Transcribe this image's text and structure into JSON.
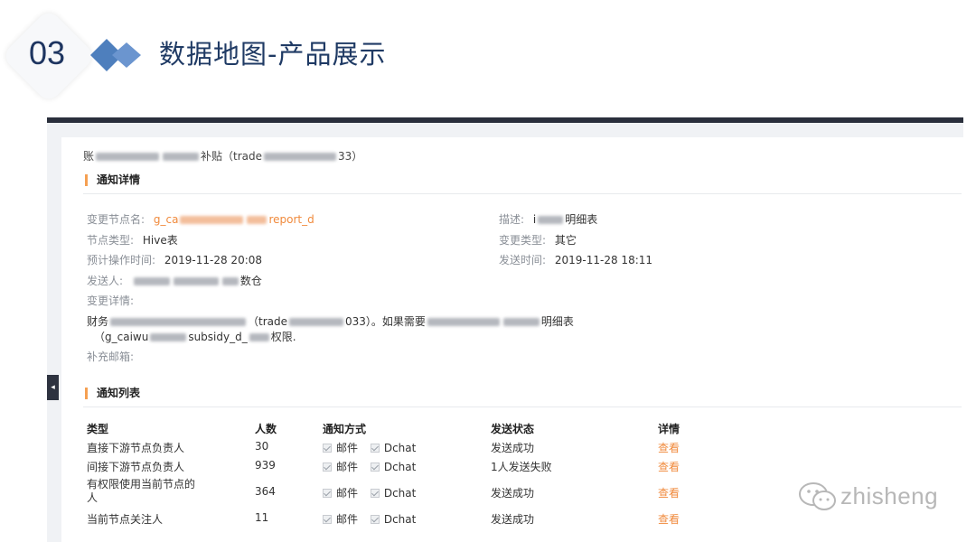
{
  "slide": {
    "number": "03",
    "title": "数据地图-产品展示"
  },
  "breadcrumb": {
    "prefix": "账",
    "middle": "补贴（trade",
    "suffix": "33）"
  },
  "detail_section": {
    "title": "通知详情",
    "fields": {
      "node_name_label": "变更节点名:",
      "node_name_prefix": "g_ca",
      "node_name_suffix": "report_d",
      "desc_label": "描述:",
      "desc_prefix": "i",
      "desc_suffix": "明细表",
      "node_type_label": "节点类型:",
      "node_type_value": "Hive表",
      "change_type_label": "变更类型:",
      "change_type_value": "其它",
      "planned_time_label": "预计操作时间:",
      "planned_time_value": "2019-11-28 20:08",
      "send_time_label": "发送时间:",
      "send_time_value": "2019-11-28 18:11",
      "sender_label": "发送人:",
      "sender_suffix": "数仓",
      "change_detail_label": "变更详情:",
      "change_detail_line1_a": "财务",
      "change_detail_line1_b": "（trade",
      "change_detail_line1_c": "033）。如果需要",
      "change_detail_line1_d": "明细表",
      "change_detail_line2_a": "（g_caiwu",
      "change_detail_line2_b": "subsidy_d_",
      "change_detail_line2_c": "权限.",
      "extra_email_label": "补充邮箱:"
    }
  },
  "list_section": {
    "title": "通知列表",
    "headers": [
      "类型",
      "人数",
      "通知方式",
      "发送状态",
      "详情"
    ],
    "method_labels": [
      "邮件",
      "Dchat"
    ],
    "rows": [
      {
        "type": "直接下游节点负责人",
        "count": "30",
        "status": "发送成功",
        "detail": "查看"
      },
      {
        "type": "间接下游节点负责人",
        "count": "939",
        "status": "1人发送失败",
        "detail": "查看"
      },
      {
        "type": "有权限使用当前节点的\n人",
        "count": "364",
        "status": "发送成功",
        "detail": "查看"
      },
      {
        "type": "当前节点关注人",
        "count": "11",
        "status": "发送成功",
        "detail": "查看"
      }
    ]
  },
  "watermark": {
    "text": "zhisheng",
    "icon": "wechat-icon"
  },
  "colors": {
    "accent_orange": "#f08a3c",
    "title_blue": "#1f3a64",
    "diamond_blue": "#4e7fbd"
  }
}
